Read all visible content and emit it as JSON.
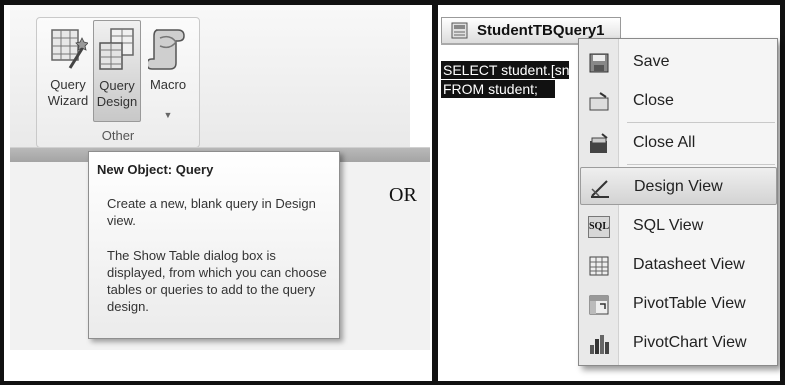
{
  "ribbon": {
    "buttons": {
      "query_wizard": {
        "line1": "Query",
        "line2": "Wizard"
      },
      "query_design": {
        "line1": "Query",
        "line2": "Design"
      },
      "macro": {
        "line1": "Macro"
      }
    },
    "group_label": "Other"
  },
  "tooltip": {
    "title": "New Object: Query",
    "paragraph1": "Create a new, blank query in Design view.",
    "paragraph2": "The Show Table dialog box is displayed, from which you can choose tables or queries to add to the query design."
  },
  "separator_text": "OR",
  "query_window": {
    "tab_title": "StudentTBQuery1",
    "sql_line1": "SELECT student.[sn",
    "sql_line2": "FROM student;"
  },
  "context_menu": {
    "items": [
      {
        "label": "Save",
        "icon": "save-icon"
      },
      {
        "label": "Close",
        "icon": "close-icon"
      },
      {
        "label": "Close All",
        "icon": "close-all-icon"
      },
      {
        "label": "Design View",
        "icon": "design-view-icon",
        "highlighted": true
      },
      {
        "label": "SQL View",
        "icon": "sql-view-icon"
      },
      {
        "label": "Datasheet View",
        "icon": "datasheet-view-icon"
      },
      {
        "label": "PivotTable View",
        "icon": "pivottable-view-icon"
      },
      {
        "label": "PivotChart View",
        "icon": "pivotchart-view-icon"
      }
    ]
  }
}
